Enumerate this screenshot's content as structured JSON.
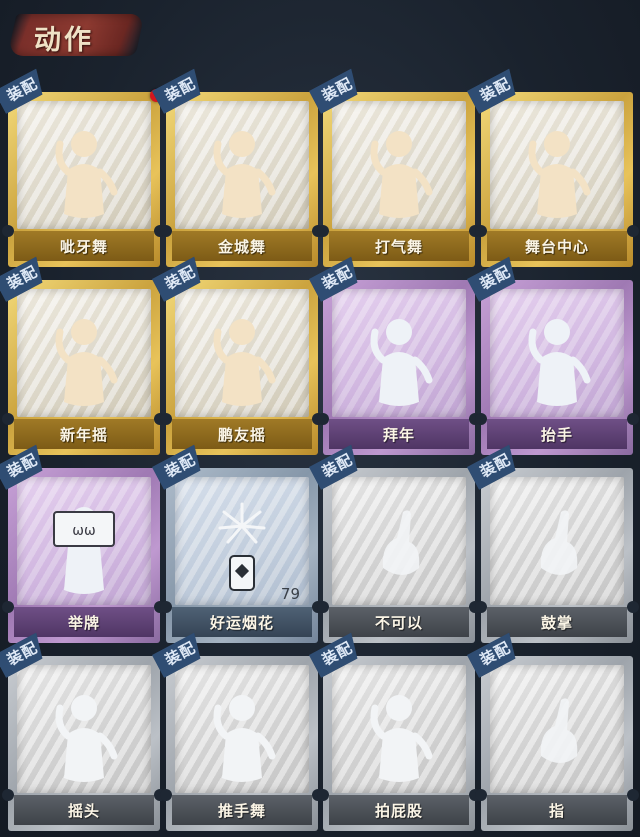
{
  "header": {
    "title": "动作"
  },
  "equip_label": "装配",
  "cards": [
    {
      "name": "呲牙舞",
      "rarity": "gold",
      "icon": "dancer-music-icon",
      "new": true
    },
    {
      "name": "金城舞",
      "rarity": "gold",
      "icon": "dancer-wave-icon"
    },
    {
      "name": "打气舞",
      "rarity": "gold",
      "icon": "dancer-cheer-icon"
    },
    {
      "name": "舞台中心",
      "rarity": "gold",
      "icon": "dancer-pose-icon"
    },
    {
      "name": "新年摇",
      "rarity": "gold",
      "icon": "dancer-clap-icon"
    },
    {
      "name": "鹏友摇",
      "rarity": "gold",
      "icon": "dancer-point-icon"
    },
    {
      "name": "拜年",
      "rarity": "purple",
      "icon": "bow-icon"
    },
    {
      "name": "抬手",
      "rarity": "purple",
      "icon": "raise-hand-icon"
    },
    {
      "name": "举牌",
      "rarity": "purple",
      "icon": "sign-board-icon"
    },
    {
      "name": "好运烟花",
      "rarity": "blue",
      "icon": "firework-icon",
      "count": "79"
    },
    {
      "name": "不可以",
      "rarity": "grey",
      "icon": "finger-no-icon"
    },
    {
      "name": "鼓掌",
      "rarity": "grey",
      "icon": "clap-hands-icon"
    },
    {
      "name": "摇头",
      "rarity": "grey",
      "icon": "shake-head-icon"
    },
    {
      "name": "推手舞",
      "rarity": "grey",
      "icon": "push-hands-icon"
    },
    {
      "name": "拍屁股",
      "rarity": "grey",
      "icon": "pat-icon"
    },
    {
      "name": "指",
      "rarity": "grey",
      "icon": "point-icon"
    }
  ]
}
